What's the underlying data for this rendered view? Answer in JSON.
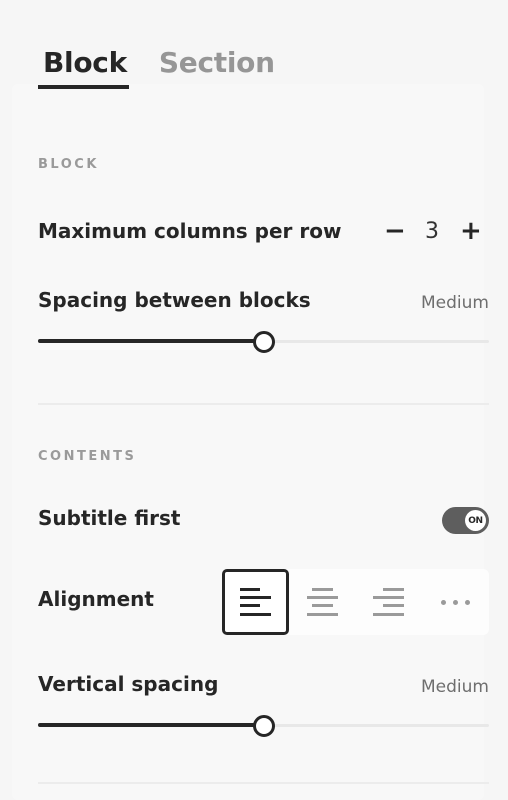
{
  "tabs": [
    {
      "label": "Block",
      "active": true
    },
    {
      "label": "Section",
      "active": false
    }
  ],
  "block_section": {
    "heading": "BLOCK",
    "max_columns": {
      "label": "Maximum columns per row",
      "value": "3",
      "decrement": "−",
      "increment": "+"
    },
    "spacing": {
      "label": "Spacing between blocks",
      "value_label": "Medium",
      "slider_fraction": 0.5
    }
  },
  "contents_section": {
    "heading": "CONTENTS",
    "subtitle_first": {
      "label": "Subtitle first",
      "state": "ON"
    },
    "alignment": {
      "label": "Alignment",
      "options": [
        {
          "name": "align-left",
          "selected": true
        },
        {
          "name": "align-center",
          "selected": false
        },
        {
          "name": "align-right",
          "selected": false
        },
        {
          "name": "more",
          "selected": false
        }
      ]
    },
    "vertical_spacing": {
      "label": "Vertical spacing",
      "value_label": "Medium",
      "slider_fraction": 0.5
    }
  },
  "colors": {
    "primary": "#262626",
    "muted": "#969696",
    "track": "#e8e8e8",
    "toggle_on": "#5e5e5e"
  }
}
